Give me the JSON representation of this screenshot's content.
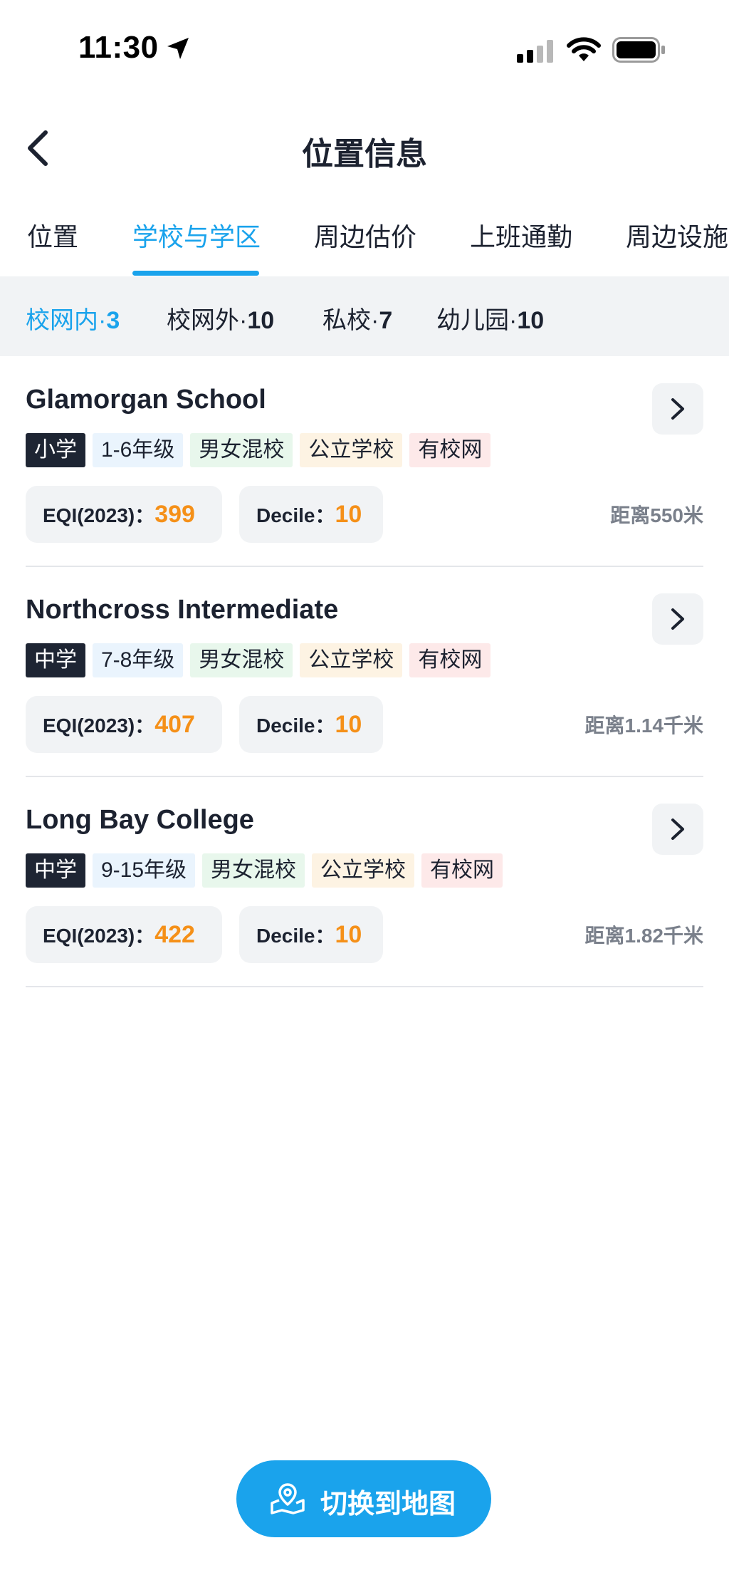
{
  "status_bar": {
    "time": "11:30",
    "icons": [
      "location-arrow-icon",
      "cellular-signal-icon",
      "wifi-icon",
      "battery-icon"
    ]
  },
  "nav": {
    "title": "位置信息",
    "back_icon": "chevron-left-icon"
  },
  "tabs": [
    {
      "label": "位置",
      "active": false
    },
    {
      "label": "学校与学区",
      "active": true
    },
    {
      "label": "周边估价",
      "active": false
    },
    {
      "label": "上班通勤",
      "active": false
    },
    {
      "label": "周边设施",
      "active": false
    }
  ],
  "filters": [
    {
      "label": "校网内·",
      "count": "3",
      "active": true
    },
    {
      "label": "校网外·",
      "count": "10",
      "active": false
    },
    {
      "label": "私校·",
      "count": "7",
      "active": false
    },
    {
      "label": "幼儿园·",
      "count": "10",
      "active": false
    }
  ],
  "schools": [
    {
      "name": "Glamorgan School",
      "tags": {
        "level": "小学",
        "grades": "1-6年级",
        "gender": "男女混校",
        "type": "公立学校",
        "zone": "有校网"
      },
      "eqi_label": "EQI(2023)：",
      "eqi_value": "399",
      "decile_label": "Decile：",
      "decile_value": "10",
      "distance": "距离550米"
    },
    {
      "name": "Northcross Intermediate",
      "tags": {
        "level": "中学",
        "grades": "7-8年级",
        "gender": "男女混校",
        "type": "公立学校",
        "zone": "有校网"
      },
      "eqi_label": "EQI(2023)：",
      "eqi_value": "407",
      "decile_label": "Decile：",
      "decile_value": "10",
      "distance": "距离1.14千米"
    },
    {
      "name": "Long Bay College",
      "tags": {
        "level": "中学",
        "grades": "9-15年级",
        "gender": "男女混校",
        "type": "公立学校",
        "zone": "有校网"
      },
      "eqi_label": "EQI(2023)：",
      "eqi_value": "422",
      "decile_label": "Decile：",
      "decile_value": "10",
      "distance": "距离1.82千米"
    }
  ],
  "map_button": {
    "label": "切换到地图",
    "icon": "map-pin-icon"
  },
  "colors": {
    "accent": "#1aa3ec",
    "score": "#f59018",
    "text": "#1c2230",
    "muted": "#7a808b",
    "filter_bg": "#f1f3f5"
  }
}
